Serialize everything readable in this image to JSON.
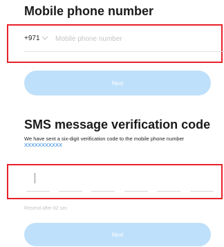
{
  "phone_section": {
    "title": "Mobile phone number",
    "country_code": "+971",
    "phone_placeholder": "Mobile phone number",
    "phone_value": ""
  },
  "buttons": {
    "next_label": "Next"
  },
  "sms_section": {
    "title": "SMS message verification code",
    "description_prefix": "We have sent a six-digit verification code to the mobile phone number ",
    "masked_number": "XXXXXXXXXXX",
    "code_digits": [
      "",
      "",
      "",
      "",
      "",
      ""
    ],
    "resend_text": "Resend after 82 sec"
  },
  "icons": {
    "country_dropdown": "chevron-down-icon"
  },
  "colors": {
    "button_disabled": "#bfe0fa",
    "highlight_border": "#e8202a",
    "link_blue": "#1778d6",
    "placeholder": "#c5c5c5"
  }
}
